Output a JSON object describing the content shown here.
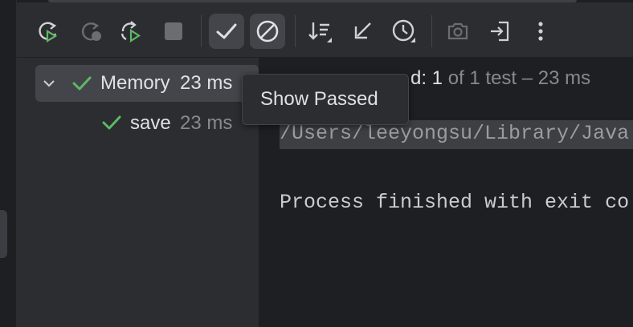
{
  "toolbar": {
    "rerun": "rerun-icon",
    "rerun_failed": "rerun-failed-icon",
    "toggle_auto_test": "toggle-auto-test-icon",
    "stop": "stop-icon",
    "show_passed": "check-icon",
    "show_ignored": "ignored-icon",
    "sort": "sort-icon",
    "import": "import-icon",
    "history": "clock-icon",
    "screenshot": "camera-icon",
    "export": "export-icon",
    "more": "more-vertical-icon"
  },
  "tooltip": {
    "text": "Show Passed"
  },
  "tree": {
    "root": {
      "name": "Memory",
      "time": "23 ms"
    },
    "child": {
      "name": "save",
      "time": "23 ms"
    }
  },
  "status": {
    "prefix_hidden": "Tests passed",
    "passed_label": "d: 1",
    "suffix": "of 1 test – 23 ms"
  },
  "console": {
    "command": "/Users/leeyongsu/Library/Java",
    "finished": "Process finished with exit co"
  },
  "colors": {
    "pass_green": "#5fb865",
    "accent_bg": "#43454a"
  }
}
